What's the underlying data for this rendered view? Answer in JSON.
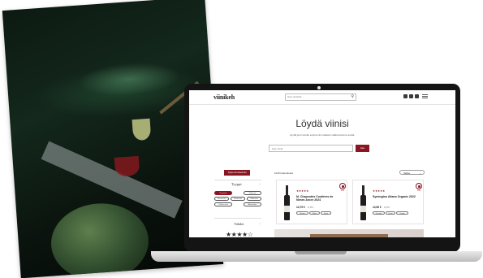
{
  "site": {
    "logo": "viinikeh",
    "search_placeholder": "Hae viineistä...",
    "header_icons": [
      "instagram-icon",
      "facebook-icon",
      "linkedin-icon"
    ]
  },
  "hero": {
    "title": "Löydä viinisi",
    "subtitle": "Löydä juuri sinulle sopiva viini selkeän valikoimamme avulla.",
    "input_placeholder": "Hae viiniä",
    "button_label": "Hae"
  },
  "filters": {
    "button_label": "Tyhjennä hakuehdot",
    "type_title": "Tyyppi",
    "type_chips": [
      {
        "label": "Punaviini",
        "active": true
      },
      {
        "label": "Valkoviini",
        "active": false
      },
      {
        "label": "Roseeviini",
        "active": false
      },
      {
        "label": "Kuohuviini",
        "active": false
      },
      {
        "label": "Jälkiruoka",
        "active": false
      },
      {
        "label": "Väkevä viini",
        "active": false
      },
      {
        "label": "Alkoholiton",
        "active": false
      }
    ],
    "rating_title": "Tähdet",
    "rating_stars": "★★★★☆"
  },
  "results": {
    "count_label": "1010 hakutulosta",
    "sort_label": "Valitse"
  },
  "products": [
    {
      "stars": "★★★★★",
      "name": "M. Chapoutier Costières de Nîmes Ancre 2024",
      "price": "14,79 €",
      "volume": "0,75 l",
      "badge": "UUSI",
      "tags": [
        "Ranska",
        "Rhône",
        "Syrah"
      ]
    },
    {
      "stars": "★★★★★",
      "name": "Symington Altano Organic 2022",
      "price": "14,98 €",
      "volume": "0,75 l",
      "badge": "UUSI",
      "tags": [
        "Portugali",
        "Douro",
        "Touriga"
      ]
    }
  ],
  "colors": {
    "accent": "#8a1622",
    "laptop_bezel": "#141414",
    "photo_dark": "#0c1a12"
  }
}
